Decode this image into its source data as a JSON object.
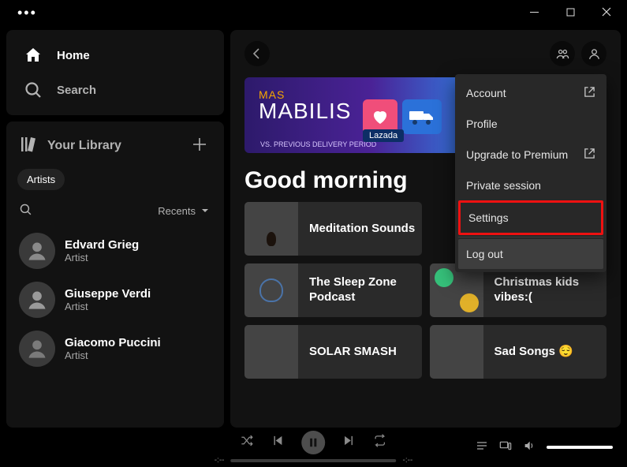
{
  "nav": {
    "home": "Home",
    "search": "Search"
  },
  "library": {
    "title": "Your Library",
    "chip": "Artists",
    "sort": "Recents",
    "items": [
      {
        "name": "Edvard Grieg",
        "sub": "Artist"
      },
      {
        "name": "Giuseppe Verdi",
        "sub": "Artist"
      },
      {
        "name": "Giacomo Puccini",
        "sub": "Artist"
      }
    ]
  },
  "banner": {
    "line1": "MAS",
    "line2": "MABILIS",
    "sub": "VS. PREVIOUS DELIVERY PERIOD",
    "brand": "Lazada"
  },
  "greeting": "Good morning",
  "cards": [
    {
      "label": "Meditation Sounds"
    },
    {
      "label": "The Sleep Zone Podcast"
    },
    {
      "label": "SOLAR SMASH"
    },
    {
      "label": "Christmas kids vibes:("
    },
    {
      "label": "Sad Songs 😌"
    }
  ],
  "menu": {
    "account": "Account",
    "profile": "Profile",
    "upgrade": "Upgrade to Premium",
    "private": "Private session",
    "settings": "Settings",
    "logout": "Log out"
  },
  "player": {
    "time_left": "-:--",
    "time_right": "-:--"
  }
}
